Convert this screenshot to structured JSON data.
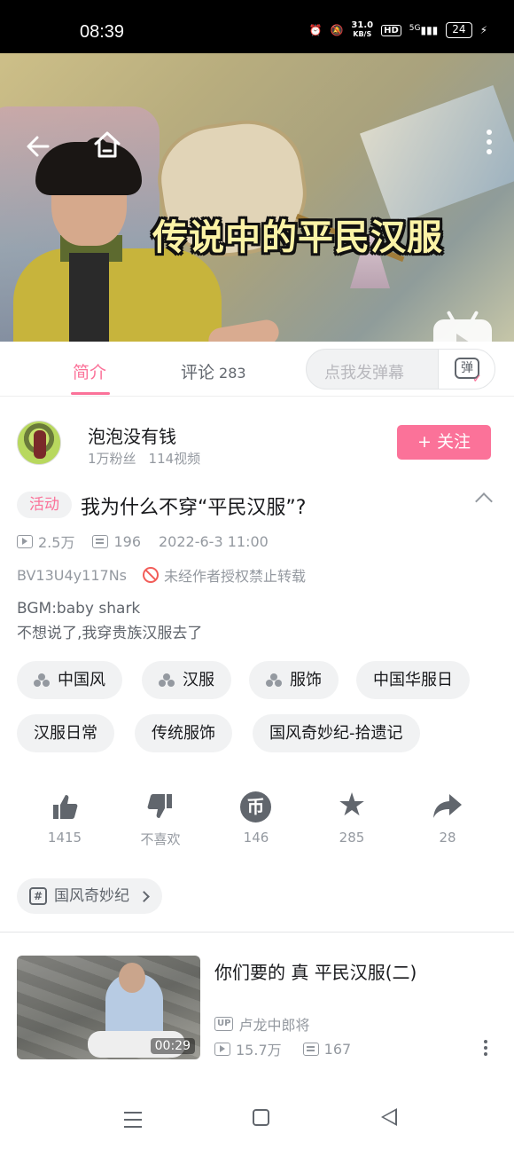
{
  "status_bar": {
    "time": "08:39",
    "net_speed_value": "31.0",
    "net_speed_unit": "KB/S",
    "hd_label": "HD",
    "signal_label": "5G",
    "battery_level": "24"
  },
  "video": {
    "overlay_title": "传说中的平民汉服"
  },
  "tabs": {
    "intro_label": "简介",
    "comments_label": "评论",
    "comments_count": "283",
    "danmaku_placeholder": "点我发弹幕",
    "danmaku_button_label": "弹"
  },
  "author": {
    "name": "泡泡没有钱",
    "fans": "1万粉丝",
    "videos": "114视频",
    "follow_label": "+ 关注"
  },
  "details": {
    "activity_tag": "活动",
    "title": "我为什么不穿“平民汉服”?",
    "views": "2.5万",
    "danmaku_count": "196",
    "publish_time": "2022-6-3 11:00",
    "bvid": "BV13U4y117Ns",
    "copyright_notice": "未经作者授权禁止转载",
    "bgm": "BGM:baby shark",
    "description": "不想说了,我穿贵族汉服去了"
  },
  "tags": [
    "中国风",
    "汉服",
    "服饰",
    "中国华服日",
    "汉服日常",
    "传统服饰",
    "国风奇妙纪-拾遗记"
  ],
  "actions": {
    "like_count": "1415",
    "dislike_label": "不喜欢",
    "coin_count": "146",
    "coin_glyph": "币",
    "favorite_count": "285",
    "share_count": "28"
  },
  "collection": {
    "label": "国风奇妙纪"
  },
  "recommendation": {
    "title": "你们要的 真 平民汉服(二)",
    "duration": "00:29",
    "up_badge": "UP",
    "uploader": "卢龙中郎将",
    "views": "15.7万",
    "danmaku_count": "167"
  },
  "colors": {
    "accent": "#fb7299",
    "text_primary": "#18191c",
    "text_secondary": "#9499a0",
    "chip_bg": "#f1f2f3",
    "video_title_fill": "#fbf3a6"
  }
}
